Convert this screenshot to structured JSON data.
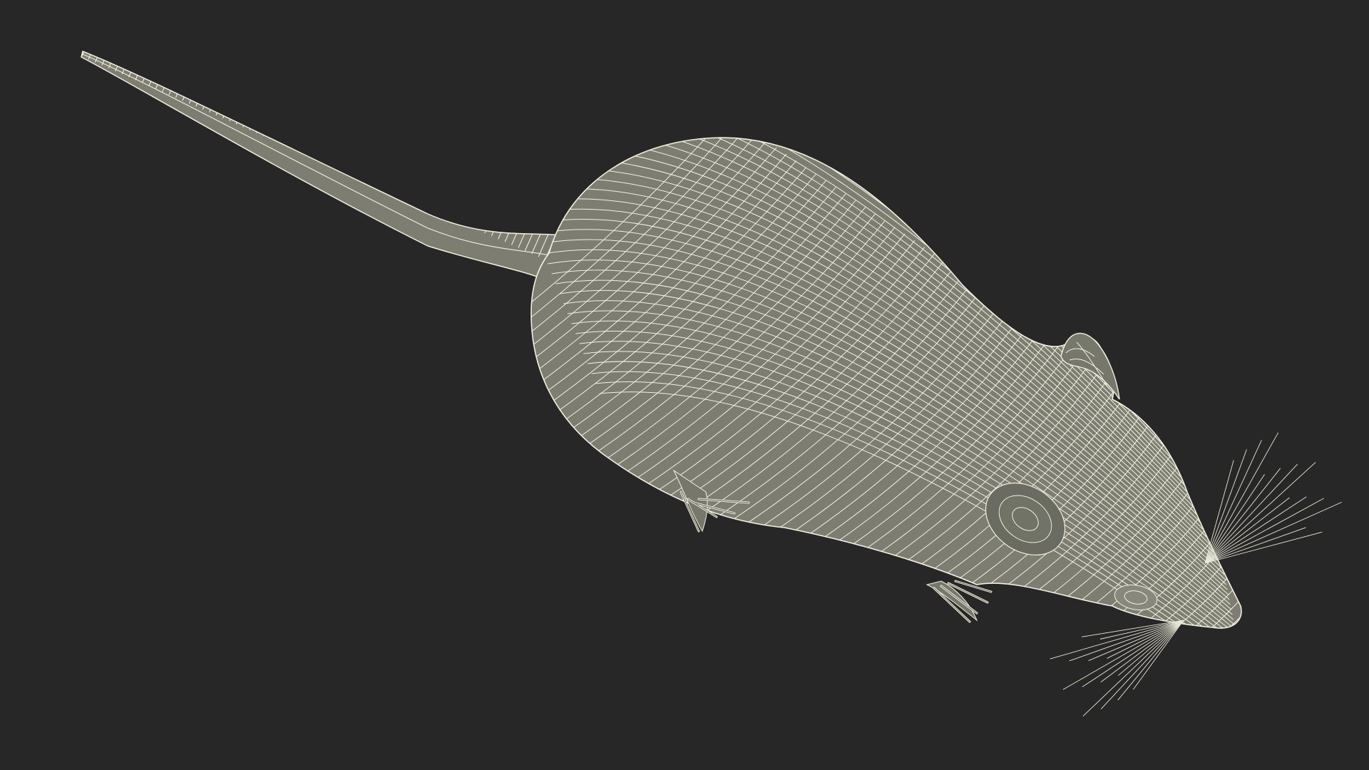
{
  "scene": {
    "subject": "rat-wireframe-model",
    "colors": {
      "background": "#272727",
      "surface": "#7d7e71",
      "surface_shadow": "#6b6c61",
      "wire": "#f2f0e0",
      "whisker": "#e8e6d6"
    }
  }
}
